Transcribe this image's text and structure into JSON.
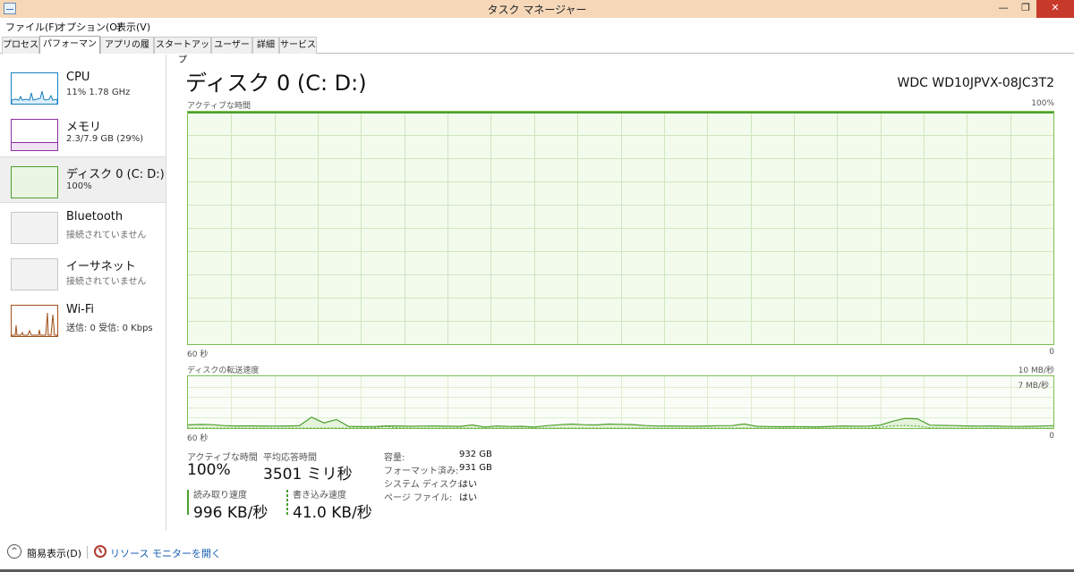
{
  "window": {
    "title": "タスク マネージャー",
    "min_glyph": "—",
    "max_glyph": "❐",
    "close_glyph": "✕"
  },
  "menu": [
    "ファイル(F)",
    "オプション(O)",
    "表示(V)"
  ],
  "tabs": [
    {
      "label": "プロセス",
      "active": false
    },
    {
      "label": "パフォーマンス",
      "active": true
    },
    {
      "label": "アプリの履歴",
      "active": false
    },
    {
      "label": "スタートアップ",
      "active": false
    },
    {
      "label": "ユーザー",
      "active": false
    },
    {
      "label": "詳細",
      "active": false
    },
    {
      "label": "サービス",
      "active": false
    }
  ],
  "devices": [
    {
      "name": "CPU",
      "sub": "11% 1.78 GHz",
      "color": "#1a7fc0"
    },
    {
      "name": "メモリ",
      "sub": "2.3/7.9 GB (29%)",
      "color": "#8b2fa1"
    },
    {
      "name": "ディスク 0 (C: D:)",
      "sub": "100%",
      "color": "#4c9f2e"
    },
    {
      "name": "Bluetooth",
      "sub": "接続されていません",
      "color": "#b8b8b8"
    },
    {
      "name": "イーサネット",
      "sub": "接続されていません",
      "color": "#b8b8b8"
    },
    {
      "name": "Wi-Fi",
      "sub": "送信: 0 受信: 0 Kbps",
      "color": "#a0521e"
    }
  ],
  "main": {
    "title": "ディスク 0 (C: D:)",
    "model": "WDC WD10JPVX-08JC3T2",
    "graph1": {
      "label": "アクティブな時間",
      "max_label": "100%",
      "left_label": "60 秒",
      "right_label": "0"
    },
    "graph2": {
      "label": "ディスクの転送速度",
      "max_label": "10 MB/秒",
      "inner_label": "7 MB/秒",
      "left_label": "60 秒",
      "right_label": "0",
      "read_series": [
        0.62,
        0.7,
        0.65,
        0.46,
        0.41,
        0.43,
        0.41,
        0.4,
        0.41,
        0.45,
        2.1,
        1.0,
        1.65,
        0.32,
        0.27,
        0.3,
        0.42,
        0.41,
        0.35,
        0.39,
        0.41,
        0.36,
        0.33,
        0.6,
        0.21,
        0.41,
        0.31,
        0.34,
        0.2,
        0.46,
        0.63,
        0.78,
        0.66,
        0.6,
        0.77,
        0.72,
        0.67,
        0.49,
        0.4,
        0.42,
        0.39,
        0.37,
        0.41,
        0.46,
        0.49,
        0.8,
        0.35,
        0.29,
        0.25,
        0.27,
        0.25,
        0.24,
        0.33,
        0.41,
        0.37,
        0.38,
        0.58,
        1.33,
        1.86,
        1.8,
        0.57,
        0.51,
        0.48,
        0.41,
        0.39,
        0.41,
        0.34,
        0.31,
        0.34,
        0.39,
        0.46
      ],
      "write_series": [
        0,
        0,
        0,
        0,
        0,
        0,
        0,
        0,
        0,
        0,
        0,
        0,
        0,
        0,
        0,
        0.05,
        0.3,
        0.05,
        0,
        0,
        0,
        0,
        0,
        0,
        0,
        0,
        0,
        0,
        0,
        0,
        0,
        0,
        0,
        0,
        0,
        0,
        0,
        0,
        0,
        0,
        0,
        0,
        0,
        0,
        0,
        0,
        0,
        0,
        0,
        0,
        0,
        0,
        0,
        0,
        0,
        0,
        0.15,
        0.45,
        0.5,
        0.4,
        0.05,
        0,
        0,
        0,
        0,
        0,
        0,
        0,
        0,
        0,
        0
      ],
      "y_max_mb": 10
    },
    "stats": {
      "active_label": "アクティブな時間",
      "active_value": "100%",
      "resp_label": "平均応答時間",
      "resp_value": "3501 ミリ秒",
      "read_label": "読み取り速度",
      "read_value": "996 KB/秒",
      "write_label": "書き込み速度",
      "write_value": "41.0 KB/秒"
    },
    "properties": [
      {
        "label": "容量:",
        "value": "932 GB"
      },
      {
        "label": "フォーマット済み:",
        "value": "931 GB"
      },
      {
        "label": "システム ディスク:",
        "value": "はい"
      },
      {
        "label": "ページ ファイル:",
        "value": "はい"
      }
    ]
  },
  "bottom": {
    "fewer_details": "簡易表示(D)",
    "resource_monitor": "リソース モニターを開く"
  },
  "colors": {
    "disk": "#4c9f2e",
    "titlebar": "#f6d8b9",
    "close": "#c7392b",
    "link": "#1a5fb4"
  }
}
